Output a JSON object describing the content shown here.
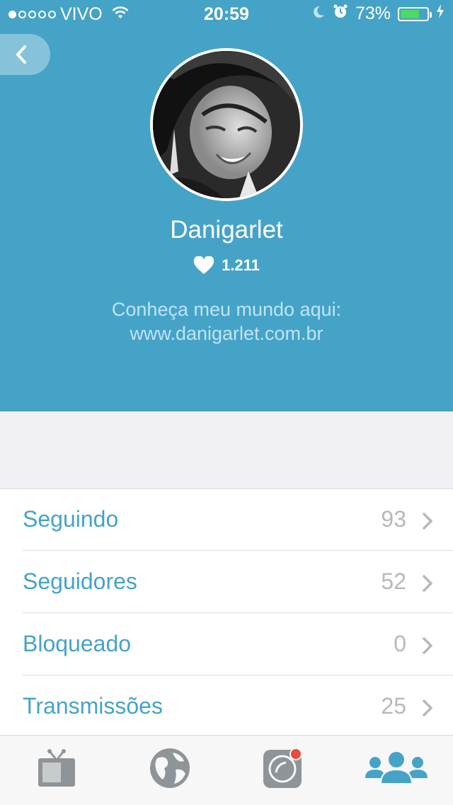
{
  "status_bar": {
    "carrier": "VIVO",
    "time": "20:59",
    "battery": "73%",
    "battery_level": 0.73,
    "signal_bars_filled": 1,
    "signal_bars_total": 5
  },
  "profile": {
    "name": "Danigarlet",
    "likes": "1.211",
    "bio_line1": "Conheça meu mundo aqui:",
    "bio_line2": "www.danigarlet.com.br"
  },
  "list": [
    {
      "label": "Seguindo",
      "count": "93"
    },
    {
      "label": "Seguidores",
      "count": "52"
    },
    {
      "label": "Bloqueado",
      "count": "0"
    },
    {
      "label": "Transmissões",
      "count": "25"
    }
  ],
  "tabs": [
    {
      "icon": "tv-icon",
      "active": false
    },
    {
      "icon": "globe-icon",
      "active": false
    },
    {
      "icon": "camera-icon",
      "active": false
    },
    {
      "icon": "people-icon",
      "active": true
    }
  ],
  "colors": {
    "header": "#45a3c8",
    "accent": "#45a3c8",
    "battery_fill": "#4cd964",
    "tab_inactive": "#8e9497",
    "notification_dot": "#e74c3c"
  }
}
